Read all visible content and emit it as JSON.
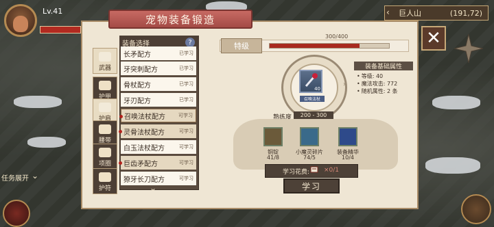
{
  "hud": {
    "level_text": "Lv.41",
    "location_name": "巨人山",
    "location_coords": "(191,72)",
    "quest_toggle_label": "任务展开"
  },
  "window": {
    "title": "宠物装备锻造",
    "close_label": "✕"
  },
  "tabs": [
    {
      "label": "武器",
      "active": false
    },
    {
      "label": "护甲",
      "active": true
    },
    {
      "label": "护肩",
      "active": false
    },
    {
      "label": "腰带",
      "active": true
    },
    {
      "label": "项圈",
      "active": true
    },
    {
      "label": "护符",
      "active": true
    }
  ],
  "list": {
    "header": "装备选择",
    "help_label": "?",
    "items": [
      {
        "name": "长矛配方",
        "status": "已学习",
        "learned": true
      },
      {
        "name": "牙突刺配方",
        "status": "已学习",
        "learned": true
      },
      {
        "name": "骨杖配方",
        "status": "已学习",
        "learned": true
      },
      {
        "name": "牙刃配方",
        "status": "已学习",
        "learned": true
      },
      {
        "name": "召唤法杖配方",
        "status": "可学习",
        "learned": false,
        "selected": true,
        "dot": true
      },
      {
        "name": "灵骨法杖配方",
        "status": "可学习",
        "learned": false,
        "dot": true
      },
      {
        "name": "白玉法杖配方",
        "status": "可学习",
        "learned": false
      },
      {
        "name": "巨齿矛配方",
        "status": "可学习",
        "learned": false,
        "dot": true
      },
      {
        "name": "獠牙长刀配方",
        "status": "可学习",
        "learned": false
      }
    ],
    "more_label": "⌄"
  },
  "grade": {
    "label": "特级",
    "value_text": "300/400",
    "current": 300,
    "max": 400
  },
  "pet_item": {
    "level_text": "40",
    "name": "召唤法杖"
  },
  "attributes": {
    "title": "装备基础属性",
    "rows": [
      "等级: 40",
      "魔法攻击: 772",
      "随机属性: 2 条"
    ]
  },
  "proficiency": {
    "label": "熟练度",
    "value": "200 - 300"
  },
  "materials": [
    {
      "name": "铜锭",
      "count": "41/8",
      "color": "#6b5a3a"
    },
    {
      "name": "小魔灵碎片",
      "count": "74/5",
      "color": "#3a6a8a"
    },
    {
      "name": "装备精华",
      "count": "10/4",
      "color": "#2e4a8a"
    }
  ],
  "cost": {
    "label": "学习花费:",
    "value": "×0/1"
  },
  "learn_button": "学习",
  "colors": {
    "title_plate": "#b55a54",
    "grade_fill": "#a82a1f",
    "panel_bg": "#efe6d4"
  }
}
